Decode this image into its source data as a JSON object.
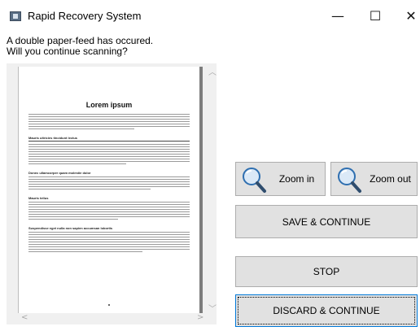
{
  "window": {
    "title": "Rapid Recovery System",
    "minimize_glyph": "—",
    "maximize_glyph": "☐",
    "close_glyph": "✕"
  },
  "prompt": {
    "line1": "A double paper-feed has occured.",
    "line2": "Will you continue scanning?"
  },
  "preview": {
    "document_title": "Lorem ipsum",
    "headings": [
      "Mauris ultricies tincidunt lectus",
      "Donec ullamcorper quam molestie dolor",
      "Mauris tellus",
      "Suspendisse eget nulla non sapien accumsan lobortis"
    ]
  },
  "buttons": {
    "zoom_in": "Zoom in",
    "zoom_out": "Zoom out",
    "save_continue": "SAVE & CONTINUE",
    "stop": "STOP",
    "discard_continue": "DISCARD & CONTINUE"
  },
  "icons": {
    "zoom_in": "magnifier-plus-icon",
    "zoom_out": "magnifier-minus-icon",
    "app": "scanner-app-icon"
  }
}
